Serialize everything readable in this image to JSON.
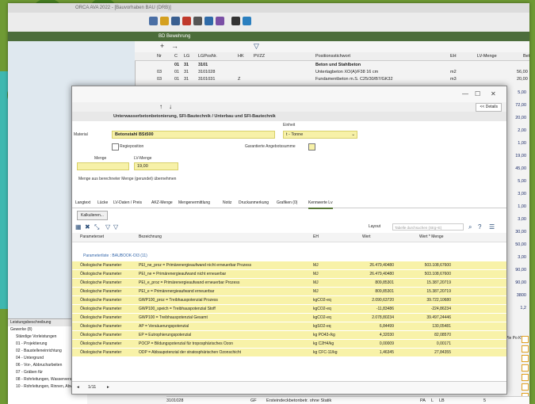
{
  "titlebar": {
    "text": "ORCA AVA 2022 - [Bauvorhaben BAU (DRB)]"
  },
  "breadcrumb": {
    "text": "BD  Bewehrung"
  },
  "grid": {
    "headers": [
      "Nr",
      "C",
      "LG",
      "LGPosNr.",
      "HK",
      "PVZZ",
      "Positionsstichwort",
      "EH",
      "LV-Menge",
      "Betrag"
    ],
    "rows": [
      {
        "a": "",
        "b": "01",
        "c": "31",
        "d": "3101",
        "e": "",
        "f": "Beton und Stahlbeton",
        "g": "",
        "h": "",
        "bold": true
      },
      {
        "a": "03",
        "b": "01",
        "c": "31",
        "d": "3101028",
        "e": "",
        "f": "Untertagbeton XO(A)/F38 16 cm",
        "g": "m2",
        "h": "56,00"
      },
      {
        "a": "03",
        "b": "01",
        "c": "31",
        "d": "3101031",
        "e": "Z",
        "f": "Fundamentbeton m.S. C25/30/B7/GK32",
        "g": "m3",
        "h": "20,00"
      }
    ]
  },
  "right_numbers": [
    "5,00",
    "72,00",
    "20,00",
    "2,00",
    "1,00",
    "19,00",
    "45,00",
    "5,00",
    "3,00",
    "1,00",
    "3,00",
    "30,00",
    "50,00",
    "3,00",
    "90,00",
    "90,00",
    "3800",
    "1,2"
  ],
  "dialog": {
    "nav_details": "<< Details",
    "path": "Unterwasserbetonbetonierung, SFI-Bautechnik / Unterbau und SFI-Bautechnik",
    "form": {
      "einheit_label": "Einheit",
      "einheit_value": "t - Tonne",
      "material_label": "Material",
      "material_value": "Betonstahl BSt500",
      "regieposition_label": "Regieposition",
      "garantierte_label": "Garantierte Angebotssumme",
      "menge_label": "LV-Menge",
      "menge_value": "19,00",
      "berech_label": "Menge",
      "berech_value": "",
      "uebernehmen_text": "Menge aus berechneter Menge (gerundet) übernehmen"
    },
    "tabs": [
      "Langtext",
      "Lücke",
      "LV-Daten / Preis",
      "AKZ-Menge",
      "Mengenermittlung",
      "Notiz",
      "Druckanmerkung",
      "Grafiken (0)",
      "Kennwerte Lv"
    ],
    "calc_button": "Kalkulieren...",
    "layout_label": "Layout",
    "search_placeholder": "Tabelle durchsuchen (Strg+E)",
    "table_headers": [
      "Parameterset",
      "Bezeichnung",
      "EH",
      "Wert",
      "Wert * Menge"
    ],
    "group_label": "Parameterliste : BAUBOOK-OI3 (11)",
    "rows": [
      {
        "set": "Ökologische Parameter",
        "bez": "PEI_ne_proz = Primärenergieaufwand nicht erneuerbar Prozess",
        "eh": "MJ",
        "wert": "26.479,40480",
        "wm": "503.108,67600"
      },
      {
        "set": "Ökologische Parameter",
        "bez": "PEI_ne = Primärenergieaufwand nicht erneuerbar",
        "eh": "MJ",
        "wert": "26.479,40480",
        "wm": "503.108,67600"
      },
      {
        "set": "Ökologische Parameter",
        "bez": "PEI_e_proz = Primärenergieaufwand erneuerbar Prozess",
        "eh": "MJ",
        "wert": "809,85301",
        "wm": "15.387,20719"
      },
      {
        "set": "Ökologische Parameter",
        "bez": "PEI_e = Primärenergieaufwand erneuerbar",
        "eh": "MJ",
        "wert": "809,85301",
        "wm": "15.387,20719"
      },
      {
        "set": "Ökologische Parameter",
        "bez": "GWP100_proz = Treibhauspotenzial Prozess",
        "eh": "kgCO2-eq",
        "wert": "2.090,63720",
        "wm": "39.722,10680"
      },
      {
        "set": "Ökologische Parameter",
        "bez": "GWP100_speich = Treibhauspotenzial Stoff",
        "eh": "kgCO2-eq",
        "wert": "-11,83486",
        "wm": "-224,86234"
      },
      {
        "set": "Ökologische Parameter",
        "bez": "GWP100 = Treibhauspotenzial Gesamt",
        "eh": "kgCO2-eq",
        "wert": "2.078,80234",
        "wm": "39.497,24446"
      },
      {
        "set": "Ökologische Parameter",
        "bez": "AP = Versäuerungspotenzial",
        "eh": "kgSO2-eq",
        "wert": "6,84499",
        "wm": "130,05481"
      },
      {
        "set": "Ökologische Parameter",
        "bez": "EP = Eutrophierungspotenzial",
        "eh": "kg PO43-/kg",
        "wert": "4,32030",
        "wm": "82,08570"
      },
      {
        "set": "Ökologische Parameter",
        "bez": "POCP = Bildungspotenzial für troposphärisches Ozon",
        "eh": "kg C2H4/kg",
        "wert": "0,00009",
        "wm": "0,00171"
      },
      {
        "set": "Ökologische Parameter",
        "bez": "ODP = Abbaupotenzial der stratosphärischen Ozonschicht",
        "eh": "kg CFC-11/kg",
        "wert": "1,46345",
        "wm": "27,84355"
      }
    ],
    "pager": "1/11"
  },
  "lower_left": {
    "title": "Leistungsbeschreibung",
    "items": [
      "Gewerke (8)",
      "Ständige Vorleistungen",
      "01 - Projektierung",
      "02 - Baustelleneinrichtung",
      "04 - Untergrund",
      "06 - Vor-, Abbrucharbeiten",
      "07 - Gräben für",
      "08 - Rohrleitungen, Wasserversorgung und Grundentwässerung",
      "10 - Rohrleitungen, Rinnen, Abwasserentw. u.drück. Bauwerke"
    ]
  },
  "bottom_row": {
    "code": "3101028",
    "hk": "GF",
    "text": "Ersteindeckbetonbetr. ohne Statik",
    "eh": "PA",
    "c": "L",
    "lb": "LB",
    "n": "5"
  },
  "pp_label": "Ple Po KW"
}
